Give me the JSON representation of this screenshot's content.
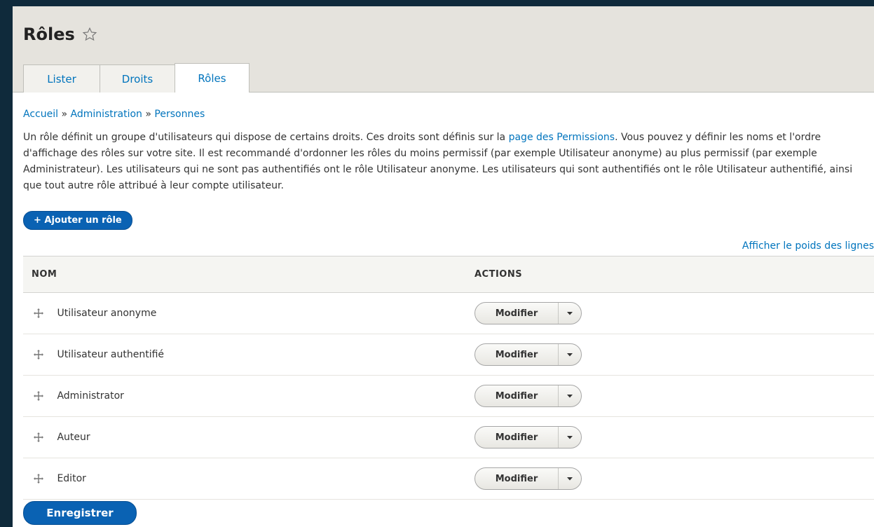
{
  "header": {
    "title": "Rôles",
    "tabs": [
      {
        "label": "Lister"
      },
      {
        "label": "Droits"
      },
      {
        "label": "Rôles"
      }
    ]
  },
  "breadcrumb": {
    "items": [
      "Accueil",
      "Administration",
      "Personnes"
    ],
    "separator": "»"
  },
  "description": {
    "part1": "Un rôle définit un groupe d'utilisateurs qui dispose de certains droits. Ces droits sont définis sur la ",
    "link": "page des Permissions",
    "part2": ". Vous pouvez y définir les noms et l'ordre d'affichage des rôles sur votre site. Il est recommandé d'ordonner les rôles du moins permissif (par exemple Utilisateur anonyme) au plus permissif (par exemple Administrateur). Les utilisateurs qui ne sont pas authentifiés ont le rôle Utilisateur anonyme. Les utilisateurs qui sont authentifiés ont le rôle Utilisateur authentifié, ainsi que tout autre rôle attribué à leur compte utilisateur."
  },
  "add_button": "+ Ajouter un rôle",
  "weights_link": "Afficher le poids des lignes",
  "table": {
    "headers": [
      "NOM",
      "ACTIONS"
    ],
    "rows": [
      {
        "name": "Utilisateur anonyme",
        "action": "Modifier"
      },
      {
        "name": "Utilisateur authentifié",
        "action": "Modifier"
      },
      {
        "name": "Administrator",
        "action": "Modifier"
      },
      {
        "name": "Auteur",
        "action": "Modifier"
      },
      {
        "name": "Editor",
        "action": "Modifier"
      }
    ]
  },
  "save_button": "Enregistrer",
  "colors": {
    "link": "#0074bd",
    "primary_button": "#0a62b3",
    "header_bg": "#e5e3dd"
  }
}
